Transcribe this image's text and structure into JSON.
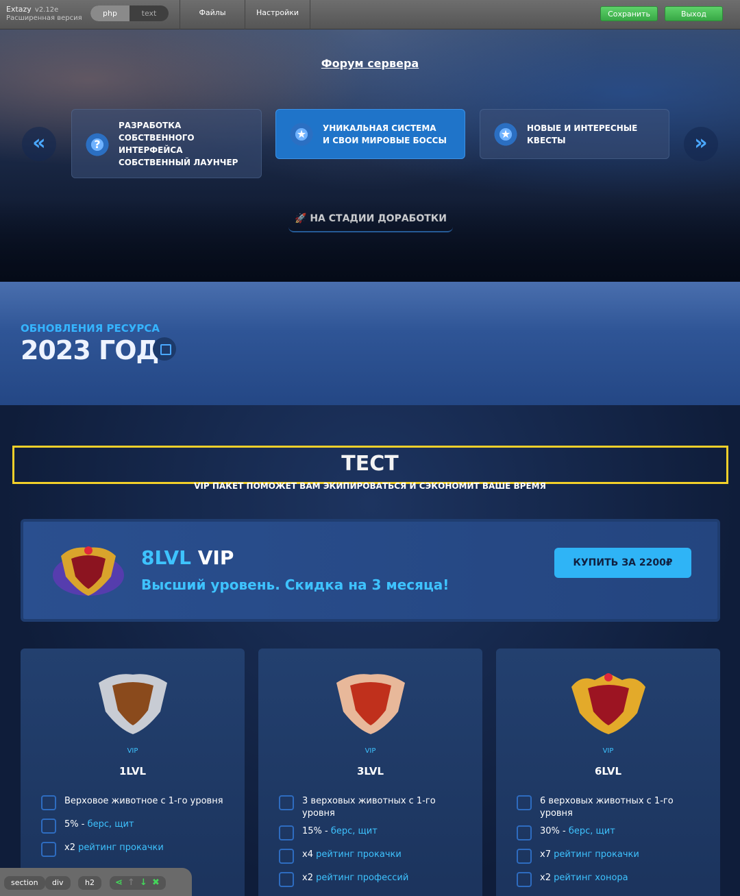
{
  "editor": {
    "brand": {
      "name": "Extazy",
      "version": "v2.12e",
      "subtitle": "Расширенная версия"
    },
    "mode": {
      "options": [
        "php",
        "text"
      ],
      "active": "php"
    },
    "menu": [
      "Файлы",
      "Настройки"
    ],
    "save_label": "Сохранить",
    "exit_label": "Выход",
    "breadcrumbs": [
      "section",
      "div",
      "h2"
    ],
    "tool_icons": [
      "share-icon",
      "arrow-up-icon",
      "arrow-down-icon",
      "close-icon"
    ]
  },
  "hero": {
    "forum_link": "Форум сервера",
    "features": [
      {
        "icon": "question-icon",
        "glyph": "?",
        "lines": [
          "Разработка",
          "собственного",
          "интерфейса",
          "собственный лаунчер"
        ]
      },
      {
        "icon": "star-icon",
        "glyph": "★",
        "lines": [
          "Уникальная система",
          "и свои мировые боссы"
        ]
      },
      {
        "icon": "star-icon",
        "glyph": "★",
        "lines": [
          "Новые и интересные",
          "квесты"
        ]
      }
    ],
    "stage_label": "🚀 НА СТАДИИ ДОРАБОТКИ",
    "prev_arrow": "«",
    "next_arrow": "»"
  },
  "updates": {
    "title": "ОБНОВЛЕНИЯ РЕСУРСА",
    "year": "2023 ГОД"
  },
  "vip_section": {
    "title": "ТЕСТ",
    "subtitle": "VIP ПАКЕТ ПОМОЖЕТ ВАМ ЭКИПИРОВАТЬСЯ И СЭКОНОМИТ ВАШЕ ВРЕМЯ",
    "banner": {
      "level": "8LVL",
      "vip": "VIP",
      "description": "Высший уровень. Скидка на 3 месяца!",
      "buy_label": "КУПИТЬ ЗА 2200₽"
    },
    "cards": [
      {
        "tag": "VIP",
        "level": "1LVL",
        "perks": [
          {
            "text": "Верховое животное с 1-го уровня",
            "hl": ""
          },
          {
            "text": "5% - ",
            "hl": "берс, щит"
          },
          {
            "text": "x2 ",
            "hl": "рейтинг прокачки"
          }
        ]
      },
      {
        "tag": "VIP",
        "level": "3LVL",
        "perks": [
          {
            "text": "3 верховых животных с 1-го уровня",
            "hl": ""
          },
          {
            "text": "15% - ",
            "hl": "берс, щит"
          },
          {
            "text": "x4 ",
            "hl": "рейтинг прокачки"
          },
          {
            "text": "x2 ",
            "hl": "рейтинг профессий"
          }
        ]
      },
      {
        "tag": "VIP",
        "level": "6LVL",
        "perks": [
          {
            "text": "6 верховых животных с 1-го уровня",
            "hl": ""
          },
          {
            "text": "30% - ",
            "hl": "берс, щит"
          },
          {
            "text": "x7 ",
            "hl": "рейтинг прокачки"
          },
          {
            "text": "x2 ",
            "hl": "рейтинг хонора"
          }
        ]
      }
    ]
  }
}
